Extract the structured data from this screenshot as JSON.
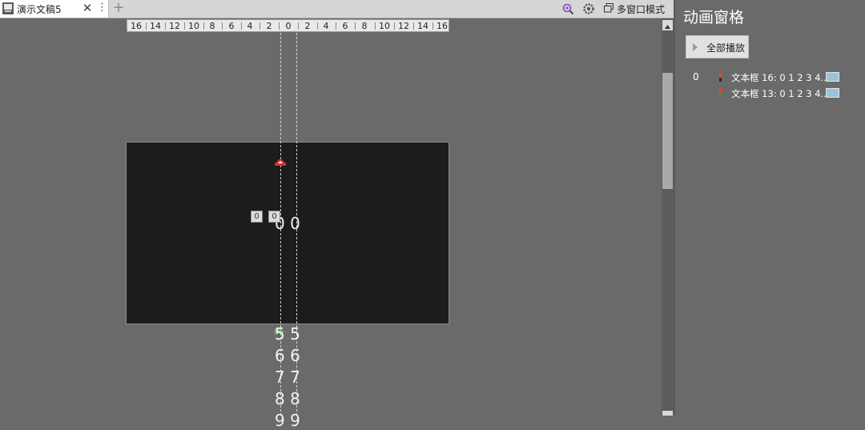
{
  "tab": {
    "title": "演示文稿5",
    "close": "✕",
    "more": "⋮",
    "new_tab": "+"
  },
  "toolbar": {
    "multi_window_label": "多窗口模式"
  },
  "ruler": {
    "ticks": [
      "16",
      "14",
      "12",
      "10",
      "8",
      "6",
      "4",
      "2",
      "0",
      "2",
      "4",
      "6",
      "8",
      "10",
      "12",
      "14",
      "16"
    ]
  },
  "slide": {
    "center_text": "0 0",
    "tags": [
      "0",
      "0"
    ],
    "below_rows": [
      "5 5",
      "6 6",
      "7 7",
      "8 8",
      "9 9"
    ]
  },
  "pane": {
    "title": "动画窗格",
    "play_all_label": "全部播放",
    "sequence_number": "0",
    "items": [
      {
        "label": "文本框 16: 0 1 2 3 4...",
        "effect_color": "#c0392b"
      },
      {
        "label": "文本框 13: 0 1 2 3 4...",
        "effect_color": "#2e7d32"
      }
    ]
  },
  "colors": {
    "background": "#6a6a6a",
    "slide": "#1c1c1c",
    "timebar": "#9ec3d8"
  }
}
